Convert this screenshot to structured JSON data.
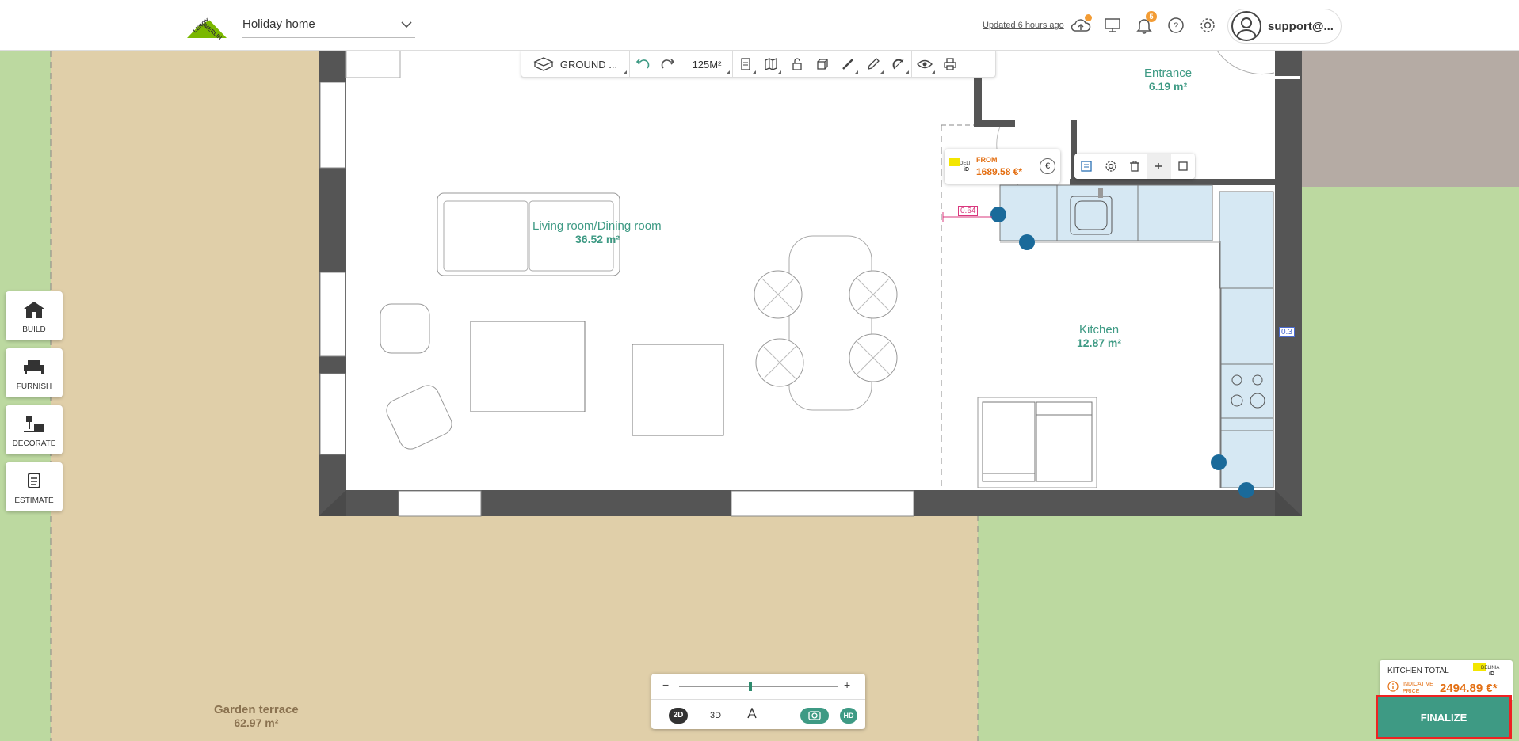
{
  "header": {
    "project_name": "Holiday home",
    "updated_text": "Updated 6 hours ago",
    "notification_count": "5",
    "username": "support@..."
  },
  "left_toolbar": [
    {
      "label": "BUILD",
      "icon": "house-icon"
    },
    {
      "label": "FURNISH",
      "icon": "sofa-icon"
    },
    {
      "label": "DECORATE",
      "icon": "lamp-icon"
    },
    {
      "label": "ESTIMATE",
      "icon": "cart-icon"
    }
  ],
  "top_toolbar": {
    "floor_label": "GROUND ...",
    "area_label": "125M²"
  },
  "rooms": {
    "living": {
      "name": "Living room/Dining room",
      "area": "36.52 m²"
    },
    "entrance": {
      "name": "Entrance",
      "area": "6.19 m²"
    },
    "kitchen": {
      "name": "Kitchen",
      "area": "12.87 m²"
    },
    "garden": {
      "name": "Garden terrace",
      "area": "62.97 m²"
    }
  },
  "measurements": {
    "left": "0.64",
    "right": "0.3"
  },
  "selected_item": {
    "from_label": "FROM",
    "price": "1689.58 €*",
    "currency_symbol": "€",
    "brand": "DELINIA iD"
  },
  "zoom_panel": {
    "mode_2d": "2D",
    "mode_3d": "3D",
    "hd": "HD",
    "minus": "−",
    "plus": "+"
  },
  "kitchen_total": {
    "label": "KITCHEN TOTAL",
    "indicative": "INDICATIVE PRICE",
    "price": "2494.89 €*",
    "brand": "DELINIA iD"
  },
  "finalize_label": "FINALIZE",
  "colors": {
    "accent_green": "#3e9a84",
    "price_orange": "#e36f13",
    "lawn": "#bcd9a0",
    "terrace": "#e0cfa9",
    "wall": "#555555",
    "selected_furniture": "#d6e8f3",
    "handle_blue": "#1a6a9a"
  }
}
